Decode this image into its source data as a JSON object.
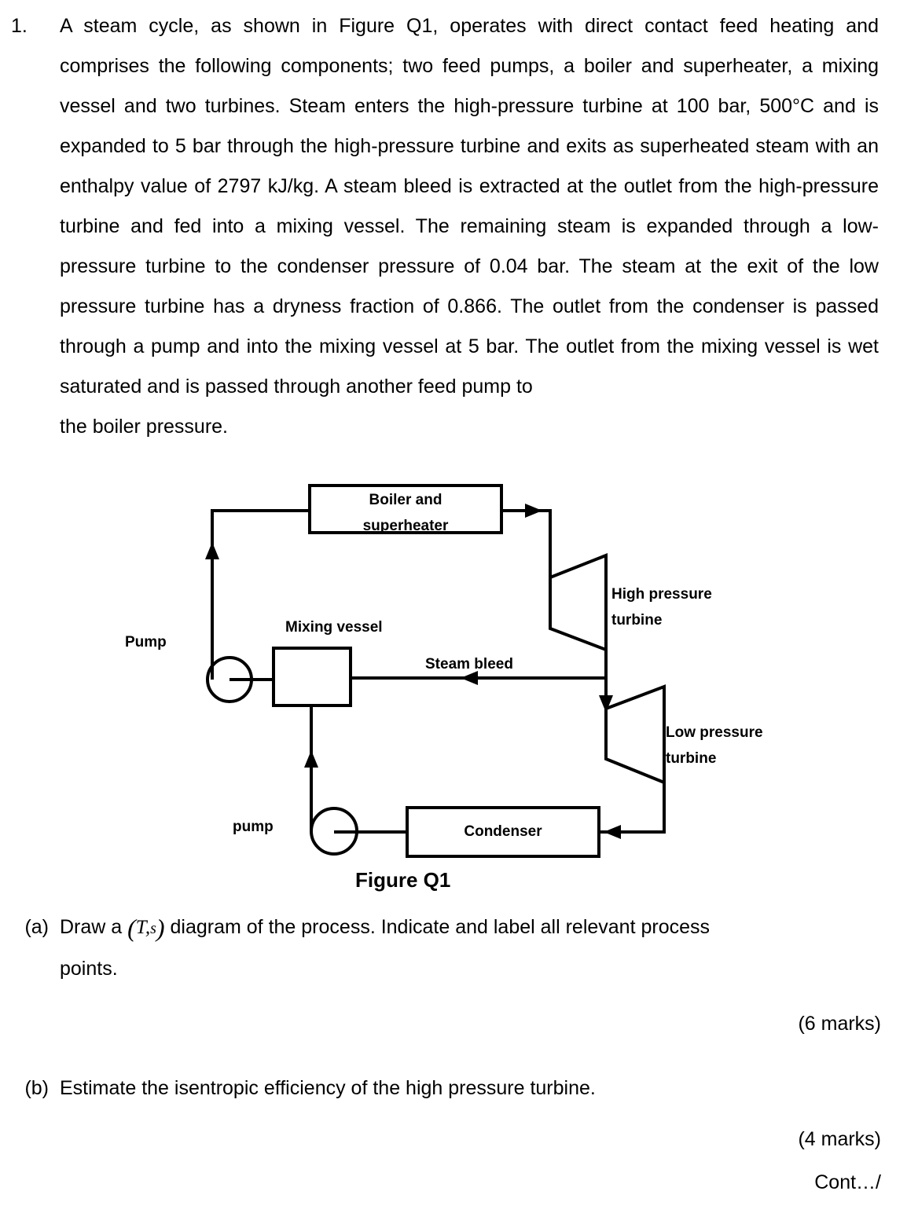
{
  "question": {
    "number": "1.",
    "body": "A steam cycle, as shown in Figure Q1, operates with direct contact feed heating and comprises the following components; two feed pumps, a boiler and superheater, a mixing vessel and two turbines.  Steam enters the high-pressure turbine at 100 bar, 500°C and is expanded to 5 bar through the high-pressure turbine and exits as superheated steam with an enthalpy value of 2797 kJ/kg.  A steam bleed is extracted at the outlet from the high-pressure turbine and fed into a mixing vessel.  The remaining steam is expanded through a low-pressure turbine to the condenser pressure of 0.04 bar.  The steam at the exit of the low pressure turbine has a dryness fraction of 0.866.  The outlet from the condenser is passed through a pump and into the mixing vessel at 5 bar.  The outlet from the mixing vessel is wet saturated and is passed through another feed pump to",
    "body_lastline": "the boiler pressure."
  },
  "figure": {
    "caption": "Figure Q1",
    "boiler_line1": "Boiler and",
    "boiler_line2": "superheater",
    "mixing_vessel": "Mixing vessel",
    "pump_upper": "Pump",
    "pump_lower": "pump",
    "steam_bleed": "Steam bleed",
    "hp_turbine_line1": "High pressure",
    "hp_turbine_line2": "turbine",
    "lp_turbine_line1": "Low pressure",
    "lp_turbine_line2": "turbine",
    "condenser": "Condenser",
    "line_color": "#000000"
  },
  "parts": {
    "a": {
      "label": "(a)",
      "text_before": "Draw a",
      "symbol_open": "(",
      "symbol_T": "T",
      "symbol_comma": ",",
      "symbol_s": "s",
      "symbol_close": ")",
      "text_after": "diagram of the process.  Indicate and label all relevant process",
      "text_second_line": "points.",
      "marks": "(6 marks)"
    },
    "b": {
      "label": "(b)",
      "text": "Estimate the isentropic efficiency of the high pressure turbine.",
      "marks": "(4 marks)"
    }
  },
  "footer": {
    "continuation": "Cont…/"
  }
}
